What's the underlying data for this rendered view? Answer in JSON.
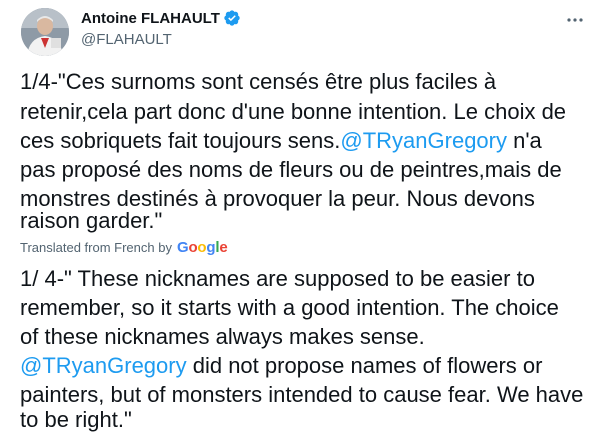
{
  "author": {
    "name": "Antoine FLAHAULT",
    "handle": "@FLAHAULT",
    "avatar_icon": "profile-photo",
    "verified_icon": "verified-badge-icon",
    "verified_color": "#1d9bf0"
  },
  "more_icon": "more-horizontal-icon",
  "original_text": {
    "line1": "1/4-\"Ces surnoms sont censés être plus faciles à",
    "line2": "retenir,cela part donc d'une bonne intention. Le choix de",
    "line3_before": "ces sobriquets fait toujours sens.",
    "line3_mention": "@TRyanGregory",
    "line3_after": " n'a",
    "line4": "pas proposé des noms de fleurs ou de peintres,mais de",
    "line5": "monstres destinés à provoquer la peur. Nous devons",
    "line6": "raison garder.\""
  },
  "translation_label": "Translated from French by",
  "google_logo": {
    "letters": [
      "G",
      "o",
      "o",
      "g",
      "l",
      "e"
    ]
  },
  "translated_text": {
    "line1": "1/ 4-\" These nicknames are supposed to be easier to",
    "line2": "remember, so it starts with a good intention. The choice",
    "line3": "of these nicknames always makes sense.",
    "line4_mention": "@TRyanGregory",
    "line4_after": " did not propose names of flowers or",
    "line5": "painters, but of monsters intended to cause fear. We have",
    "line6": "to be right.\""
  },
  "colors": {
    "link": "#1d9bf0",
    "secondary_text": "#536471",
    "primary_text": "#0f1419"
  }
}
